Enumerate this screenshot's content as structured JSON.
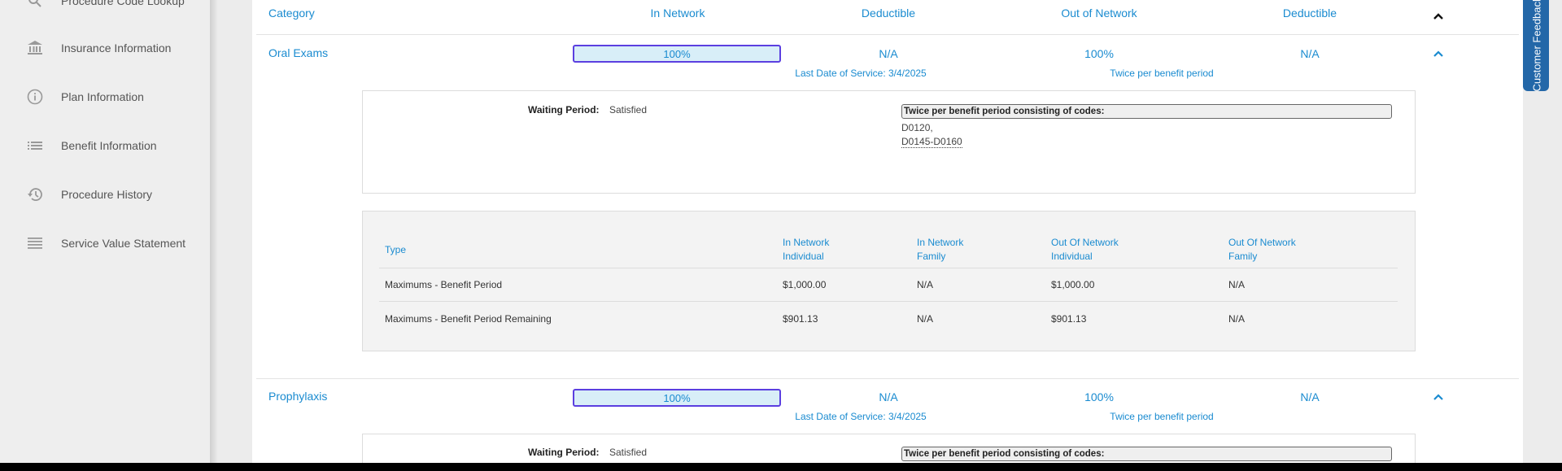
{
  "sidebar": {
    "items": [
      {
        "label": "Procedure Code Lookup",
        "icon": "search-icon"
      },
      {
        "label": "Insurance Information",
        "icon": "bank-icon"
      },
      {
        "label": "Plan Information",
        "icon": "info-icon"
      },
      {
        "label": "Benefit Information",
        "icon": "list-icon"
      },
      {
        "label": "Procedure History",
        "icon": "history-icon"
      },
      {
        "label": "Service Value Statement",
        "icon": "lines-icon"
      }
    ]
  },
  "table_header": {
    "category": "Category",
    "in_network": "In Network",
    "deductible_in": "Deductible",
    "out_network": "Out of Network",
    "deductible_out": "Deductible"
  },
  "benefits": [
    {
      "category": "Oral Exams",
      "in_network": "100%",
      "deductible_in": "N/A",
      "out_network": "100%",
      "deductible_out": "N/A",
      "last_service": "Last Date of Service: 3/4/2025",
      "frequency": "Twice per benefit period",
      "waiting_period_label": "Waiting Period:",
      "waiting_period_value": "Satisfied",
      "codes_title": "Twice per benefit period consisting of codes:",
      "codes": [
        "D0120,",
        "D0145-D0160"
      ]
    },
    {
      "category": "Prophylaxis",
      "in_network": "100%",
      "deductible_in": "N/A",
      "out_network": "100%",
      "deductible_out": "N/A",
      "last_service": "Last Date of Service: 3/4/2025",
      "frequency": "Twice per benefit period",
      "waiting_period_label": "Waiting Period:",
      "waiting_period_value": "Satisfied",
      "codes_title": "Twice per benefit period consisting of codes:"
    }
  ],
  "maximums": {
    "headers": [
      {
        "l1": "Type",
        "l2": ""
      },
      {
        "l1": "In Network",
        "l2": "Individual"
      },
      {
        "l1": "In Network",
        "l2": "Family"
      },
      {
        "l1": "Out Of Network",
        "l2": "Individual"
      },
      {
        "l1": "Out Of Network",
        "l2": "Family"
      }
    ],
    "rows": [
      [
        "Maximums - Benefit Period",
        "$1,000.00",
        "N/A",
        "$1,000.00",
        "N/A"
      ],
      [
        "Maximums - Benefit Period Remaining",
        "$901.13",
        "N/A",
        "$901.13",
        "N/A"
      ]
    ]
  },
  "feedback_label": "Customer Feedback",
  "colors": {
    "link": "#1a8bd0",
    "pill_border": "#5b3fe0",
    "pill_bg": "#d8eef8",
    "feedback": "#2367a8"
  }
}
